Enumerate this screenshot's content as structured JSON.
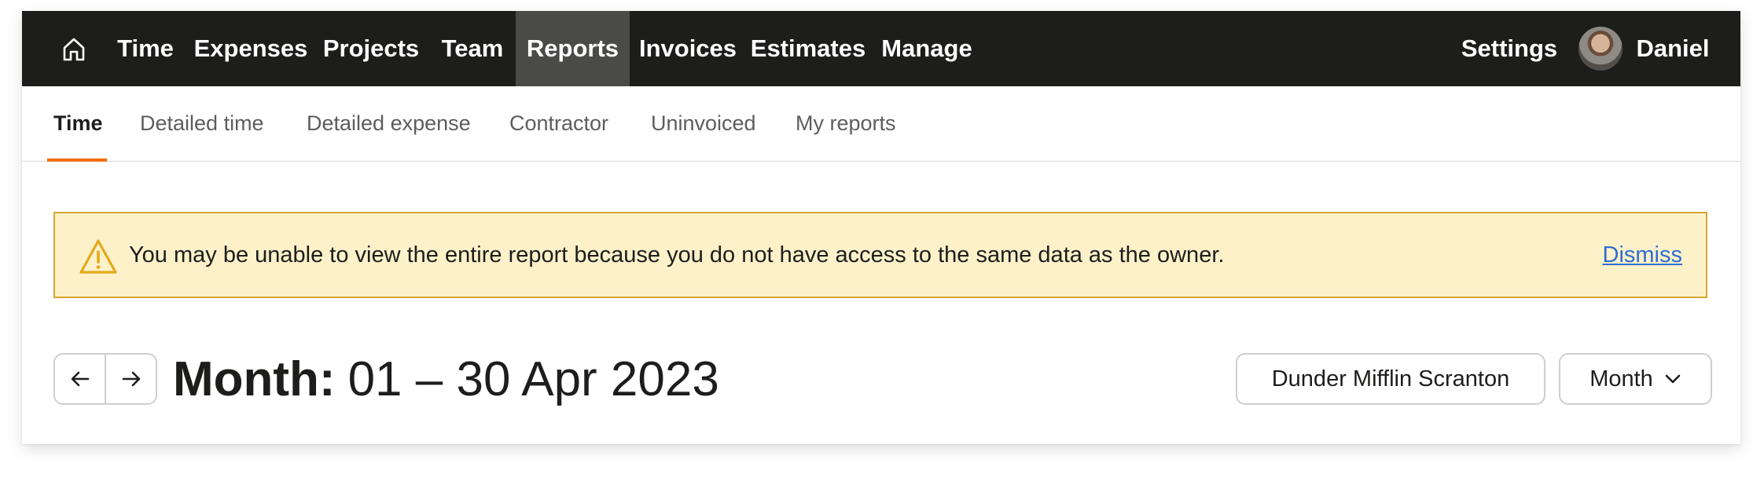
{
  "topnav": {
    "items": [
      {
        "label": "Time",
        "active": false
      },
      {
        "label": "Expenses",
        "active": false
      },
      {
        "label": "Projects",
        "active": false
      },
      {
        "label": "Team",
        "active": false
      },
      {
        "label": "Reports",
        "active": true
      },
      {
        "label": "Invoices",
        "active": false
      },
      {
        "label": "Estimates",
        "active": false
      },
      {
        "label": "Manage",
        "active": false
      }
    ],
    "settings_label": "Settings",
    "user_name": "Daniel"
  },
  "subtabs": [
    {
      "label": "Time",
      "active": true
    },
    {
      "label": "Detailed time",
      "active": false
    },
    {
      "label": "Detailed expense",
      "active": false
    },
    {
      "label": "Contractor",
      "active": false
    },
    {
      "label": "Uninvoiced",
      "active": false
    },
    {
      "label": "My reports",
      "active": false
    }
  ],
  "alert": {
    "message": "You may be unable to view the entire report because you do not have access to the same data as the owner.",
    "dismiss_label": "Dismiss"
  },
  "period": {
    "label": "Month:",
    "range": "01 – 30 Apr 2023"
  },
  "filters": {
    "client": "Dunder Mifflin Scranton",
    "timeframe": "Month"
  },
  "colors": {
    "nav_bg": "#1d1e1c",
    "nav_active_bg": "#4a4a48",
    "accent": "#f36c00",
    "alert_bg": "#fdf1c9",
    "alert_border": "#d6a531",
    "link": "#2e6dd4"
  }
}
